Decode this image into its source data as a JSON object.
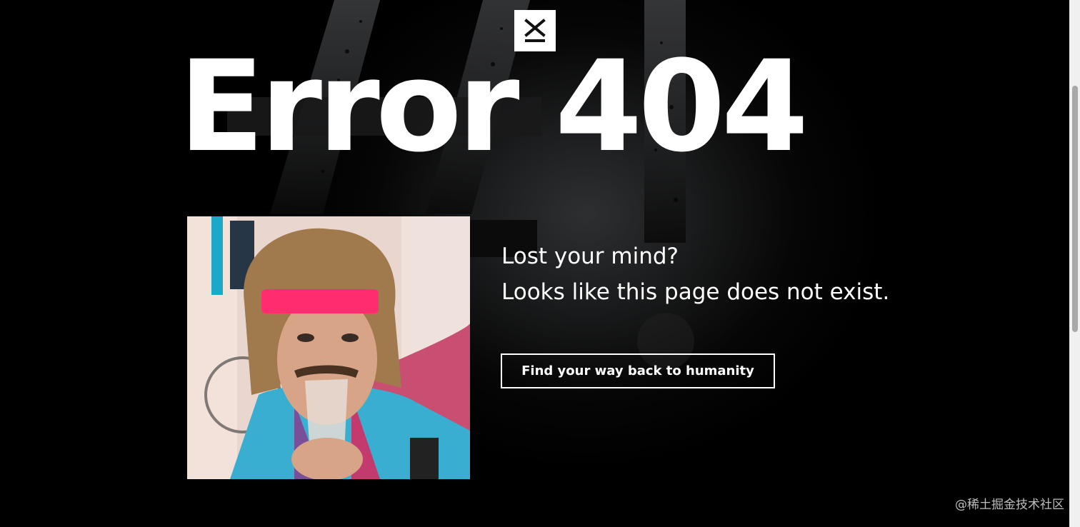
{
  "header": {
    "logo_icon": "close-x-icon"
  },
  "main": {
    "headline": "Error 404",
    "message_line1": "Lost your mind?",
    "message_line2": "Looks like this page does not exist.",
    "cta_label": "Find your way back to humanity",
    "photo_icon": "mullet-headband-photo"
  },
  "watermark": "@稀土掘金技术社区",
  "colors": {
    "background": "#000000",
    "text": "#ffffff",
    "headband": "#ff2d6f",
    "logo_bg": "#ffffff"
  }
}
